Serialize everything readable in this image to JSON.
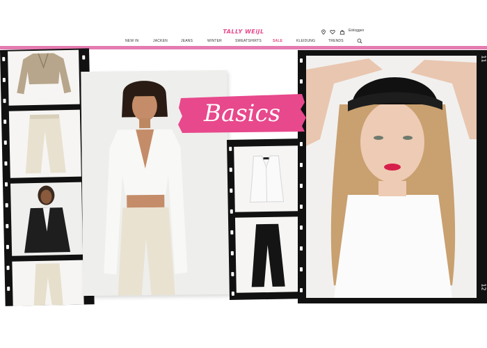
{
  "brand": {
    "logo": "TALLY WEiJL",
    "accent": "#e47bb1",
    "logo_color": "#e8488c",
    "sale_color": "#e0457b"
  },
  "header": {
    "icons": [
      "location-pin-icon",
      "heart-icon",
      "bag-icon",
      "search-icon"
    ],
    "login_label": "Einloggen"
  },
  "nav": {
    "items": [
      {
        "label": "NEW IN"
      },
      {
        "label": "JACKEN"
      },
      {
        "label": "JEANS"
      },
      {
        "label": "WINTER"
      },
      {
        "label": "SWEATSHIRTS"
      },
      {
        "label": "SALE"
      },
      {
        "label": "KLEIDUNG"
      },
      {
        "label": "TRENDS"
      }
    ]
  },
  "banner": {
    "headline": "Basics",
    "film_numbers": [
      "11",
      "12"
    ]
  }
}
